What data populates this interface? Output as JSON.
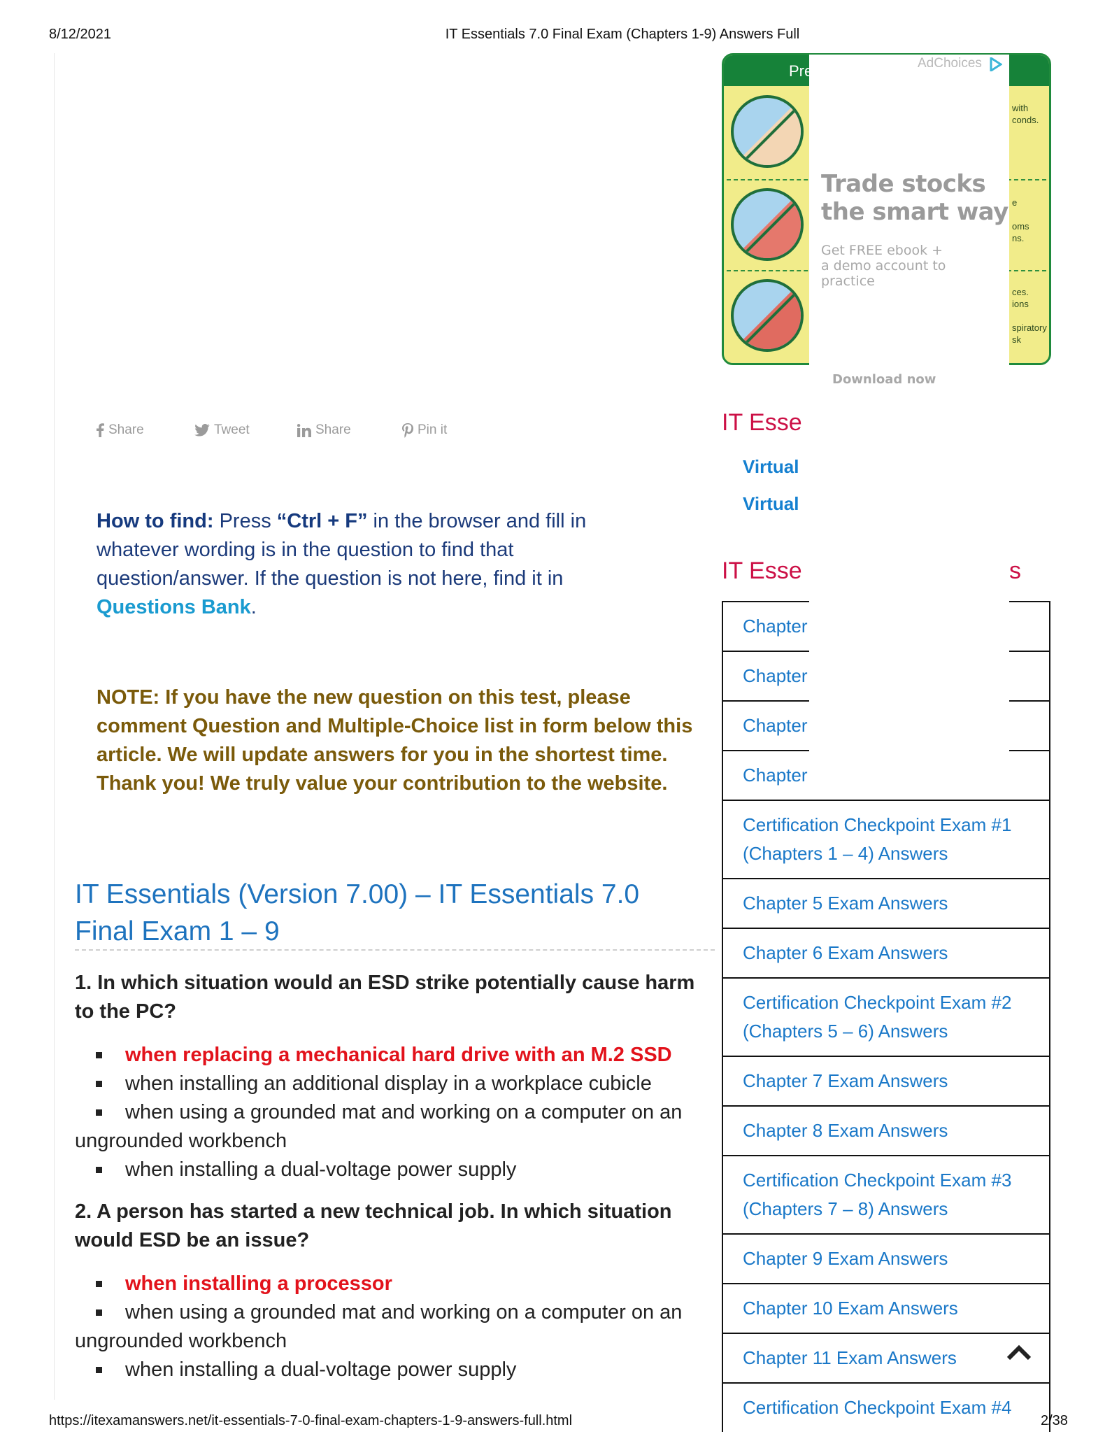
{
  "header": {
    "date": "8/12/2021",
    "title": "IT Essentials 7.0 Final Exam (Chapters 1-9) Answers Full"
  },
  "ad": {
    "banner_partial_title": "Pre",
    "adchoices_label": "AdChoices",
    "headline_line1": "Trade stocks",
    "headline_line2": "the smart way",
    "sub_line1": "Get FREE ebook +",
    "sub_line2": "a demo account to",
    "sub_line3": "practice",
    "cta": "Download now",
    "side_text": [
      {
        "lines": [
          "with",
          "conds."
        ]
      },
      {
        "lines": [
          "e",
          "",
          "oms",
          "ns."
        ]
      },
      {
        "lines": [
          "ces.",
          "ions",
          "",
          "spiratory",
          "sk"
        ]
      }
    ],
    "colors": {
      "green": "#168239",
      "yellow": "#f1ec8a"
    }
  },
  "share_bar": [
    {
      "icon": "facebook-icon",
      "label": "Share"
    },
    {
      "icon": "twitter-icon",
      "label": "Tweet"
    },
    {
      "icon": "linkedin-icon",
      "label": "Share"
    },
    {
      "icon": "pinterest-icon",
      "label": "Pin it"
    }
  ],
  "how_to_find": {
    "label": "How to find:",
    "text1": " Press ",
    "shortcut": "“Ctrl + F”",
    "text2": " in the browser and fill in whatever wording is in the question to find that question/answer. If the question is not here, find it in ",
    "link": "Questions Bank",
    "text3": "."
  },
  "note": "NOTE: If you have the new question on this test, please comment Question and Multiple-Choice list in form below this article. We will update answers for you in the shortest time. Thank you! We truly value your contribution to the website.",
  "article": {
    "heading": "IT Essentials (Version 7.00) – IT Essentials 7.0 Final Exam 1 – 9",
    "questions": [
      {
        "text": "1. In which situation would an ESD strike potentially cause harm to the PC?",
        "options": [
          {
            "text": "when replacing a mechanical hard drive with an M.2 SSD",
            "correct": true
          },
          {
            "text": "when installing an additional display in a workplace cubicle",
            "correct": false
          },
          {
            "text": "when using a grounded mat and working on a computer on an ungrounded workbench",
            "correct": false
          },
          {
            "text": "when installing a dual-voltage power supply",
            "correct": false
          }
        ]
      },
      {
        "text": "2. A person has started a new technical job. In which situation would ESD be an issue?",
        "options": [
          {
            "text": "when installing a processor",
            "correct": true
          },
          {
            "text": "when using a grounded mat and working on a computer on an ungrounded workbench",
            "correct": false
          },
          {
            "text": "when installing a dual-voltage power supply",
            "correct": false
          }
        ]
      }
    ]
  },
  "sidebar": {
    "section1_title_visible": "IT Esse",
    "section1_links": [
      "Virtual",
      "Virtual"
    ],
    "section2_title_visible": "IT Esse",
    "section2_title_tail": "s",
    "chapters": [
      {
        "label": "Chapter",
        "occluded": true
      },
      {
        "label": "Chapter",
        "occluded": true
      },
      {
        "label": "Chapter",
        "occluded": true
      },
      {
        "label": "Chapter",
        "occluded": true
      },
      {
        "label": "Certification Checkpoint Exam #1 (Chapters 1 – 4) Answers"
      },
      {
        "label": "Chapter 5 Exam Answers"
      },
      {
        "label": "Chapter 6 Exam Answers"
      },
      {
        "label": "Certification Checkpoint Exam #2 (Chapters 5 – 6) Answers"
      },
      {
        "label": "Chapter 7 Exam Answers"
      },
      {
        "label": "Chapter 8 Exam Answers"
      },
      {
        "label": "Certification Checkpoint Exam #3 (Chapters 7 – 8) Answers"
      },
      {
        "label": "Chapter 9 Exam Answers"
      },
      {
        "label": "Chapter 10 Exam Answers"
      },
      {
        "label": "Chapter 11 Exam Answers"
      },
      {
        "label": "Certification Checkpoint Exam #4"
      }
    ]
  },
  "footer": {
    "url": "https://itexamanswers.net/it-essentials-7-0-final-exam-chapters-1-9-answers-full.html",
    "page": "2/38"
  }
}
